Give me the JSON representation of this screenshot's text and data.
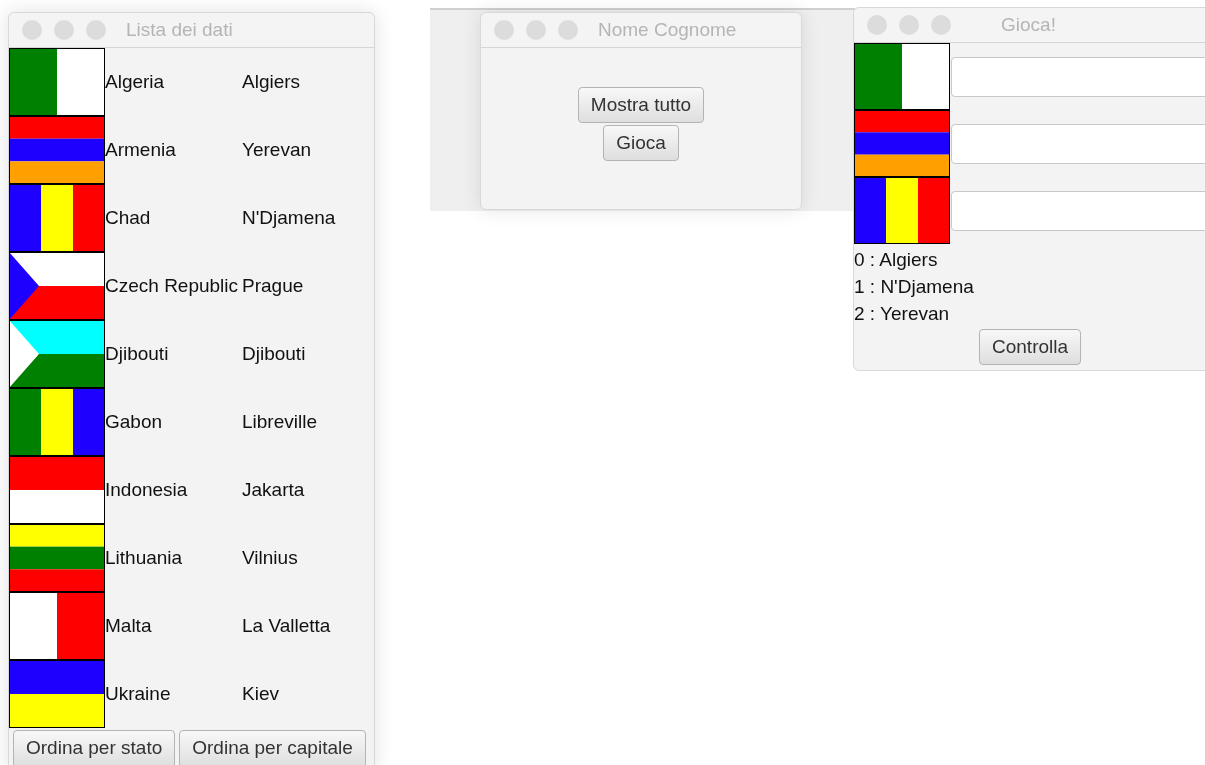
{
  "list_window": {
    "title": "Lista dei dati",
    "rows": [
      {
        "country": "Algeria",
        "capital": "Algiers",
        "flag": {
          "kind": "vertical",
          "stripes": [
            {
              "color": "#008000"
            },
            {
              "color": "#ffffff"
            }
          ]
        }
      },
      {
        "country": "Armenia",
        "capital": "Yerevan",
        "flag": {
          "kind": "horizontal",
          "stripes": [
            {
              "color": "#ff0000"
            },
            {
              "color": "#1e00ff"
            },
            {
              "color": "#ffa000"
            }
          ]
        }
      },
      {
        "country": "Chad",
        "capital": "N'Djamena",
        "flag": {
          "kind": "vertical",
          "stripes": [
            {
              "color": "#1e00ff"
            },
            {
              "color": "#ffff00"
            },
            {
              "color": "#ff0000"
            }
          ]
        }
      },
      {
        "country": "Czech Republic",
        "capital": "Prague",
        "flag": {
          "kind": "triangle",
          "stripes": [
            {
              "color": "#ffffff"
            },
            {
              "color": "#ff0000"
            }
          ],
          "triangle": {
            "color": "#1e00ff"
          }
        }
      },
      {
        "country": "Djibouti",
        "capital": "Djibouti",
        "flag": {
          "kind": "triangle",
          "stripes": [
            {
              "color": "#00ffff"
            },
            {
              "color": "#008000"
            }
          ],
          "triangle": {
            "color": "#ffffff"
          }
        }
      },
      {
        "country": "Gabon",
        "capital": "Libreville",
        "flag": {
          "kind": "vertical",
          "stripes": [
            {
              "color": "#008000"
            },
            {
              "color": "#ffff00"
            },
            {
              "color": "#1e00ff"
            }
          ]
        }
      },
      {
        "country": "Indonesia",
        "capital": "Jakarta",
        "flag": {
          "kind": "horizontal",
          "stripes": [
            {
              "color": "#ff0000"
            },
            {
              "color": "#ffffff"
            }
          ]
        }
      },
      {
        "country": "Lithuania",
        "capital": "Vilnius",
        "flag": {
          "kind": "horizontal",
          "stripes": [
            {
              "color": "#ffff00"
            },
            {
              "color": "#008000"
            },
            {
              "color": "#ff0000"
            }
          ]
        }
      },
      {
        "country": "Malta",
        "capital": "La Valletta",
        "flag": {
          "kind": "vertical",
          "stripes": [
            {
              "color": "#ffffff"
            },
            {
              "color": "#ff0000"
            }
          ]
        }
      },
      {
        "country": "Ukraine",
        "capital": "Kiev",
        "flag": {
          "kind": "horizontal",
          "stripes": [
            {
              "color": "#1e00ff"
            },
            {
              "color": "#ffff00"
            }
          ]
        }
      }
    ],
    "buttons": [
      "Ordina per stato",
      "Ordina per capitale"
    ]
  },
  "main_window": {
    "title": "Nome Cognome",
    "buttons": [
      "Mostra tutto",
      "Gioca"
    ]
  },
  "game_window": {
    "title": "Gioca!",
    "questions": [
      {
        "flag": {
          "kind": "vertical",
          "stripes": [
            {
              "color": "#008000"
            },
            {
              "color": "#ffffff"
            }
          ]
        }
      },
      {
        "flag": {
          "kind": "horizontal",
          "stripes": [
            {
              "color": "#ff0000"
            },
            {
              "color": "#1e00ff"
            },
            {
              "color": "#ffa000"
            }
          ]
        }
      },
      {
        "flag": {
          "kind": "vertical",
          "stripes": [
            {
              "color": "#1e00ff"
            },
            {
              "color": "#ffff00"
            },
            {
              "color": "#ff0000"
            }
          ]
        }
      }
    ],
    "options": [
      "0 : Algiers",
      "1 : N'Djamena",
      "2 : Yerevan"
    ],
    "button": "Controlla"
  }
}
